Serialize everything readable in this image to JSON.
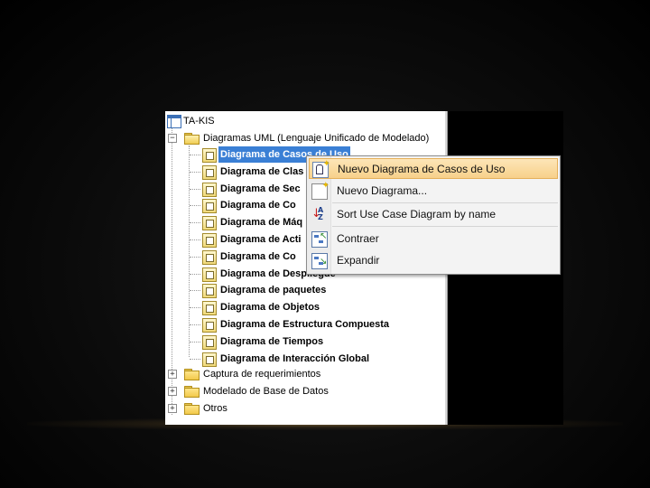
{
  "tree": {
    "root": {
      "label": "TA-KIS",
      "icon": "project-icon"
    },
    "uml_folder": {
      "label": "Diagramas UML (Lenguaje Unificado de Modelado)",
      "expander": "−",
      "icon": "open-folder-icon"
    },
    "diagrams": [
      {
        "label": "Diagrama de Casos de Uso",
        "selected": true
      },
      {
        "label": "Diagrama de Clas"
      },
      {
        "label": "Diagrama de Sec"
      },
      {
        "label": "Diagrama de Co"
      },
      {
        "label": "Diagrama de Máq"
      },
      {
        "label": "Diagrama de Acti"
      },
      {
        "label": "Diagrama de Co"
      },
      {
        "label": "Diagrama de Despliegue"
      },
      {
        "label": "Diagrama de paquetes"
      },
      {
        "label": "Diagrama de Objetos"
      },
      {
        "label": "Diagrama de Estructura Compuesta"
      },
      {
        "label": "Diagrama de Tiempos"
      },
      {
        "label": "Diagrama de Interacción Global"
      }
    ],
    "folders": [
      {
        "label": "Captura de requerimientos",
        "expander": "+"
      },
      {
        "label": "Modelado de Base de Datos",
        "expander": "+"
      },
      {
        "label": "Otros",
        "expander": "+"
      }
    ]
  },
  "context_menu": {
    "items": [
      {
        "label": "Nuevo Diagrama de Casos de Uso",
        "icon": "new-use-case-diagram-icon",
        "highlighted": true
      },
      {
        "label": "Nuevo Diagrama...",
        "icon": "new-diagram-icon"
      },
      {
        "label": "Sort Use Case Diagram by name",
        "icon": "sort-az-icon"
      },
      {
        "label": "Contraer",
        "icon": "collapse-icon"
      },
      {
        "label": "Expandir",
        "icon": "expand-icon"
      }
    ]
  },
  "colors": {
    "selection": "#3a7fd5",
    "menu_highlight": "#f7d08a",
    "background": "#000000"
  }
}
